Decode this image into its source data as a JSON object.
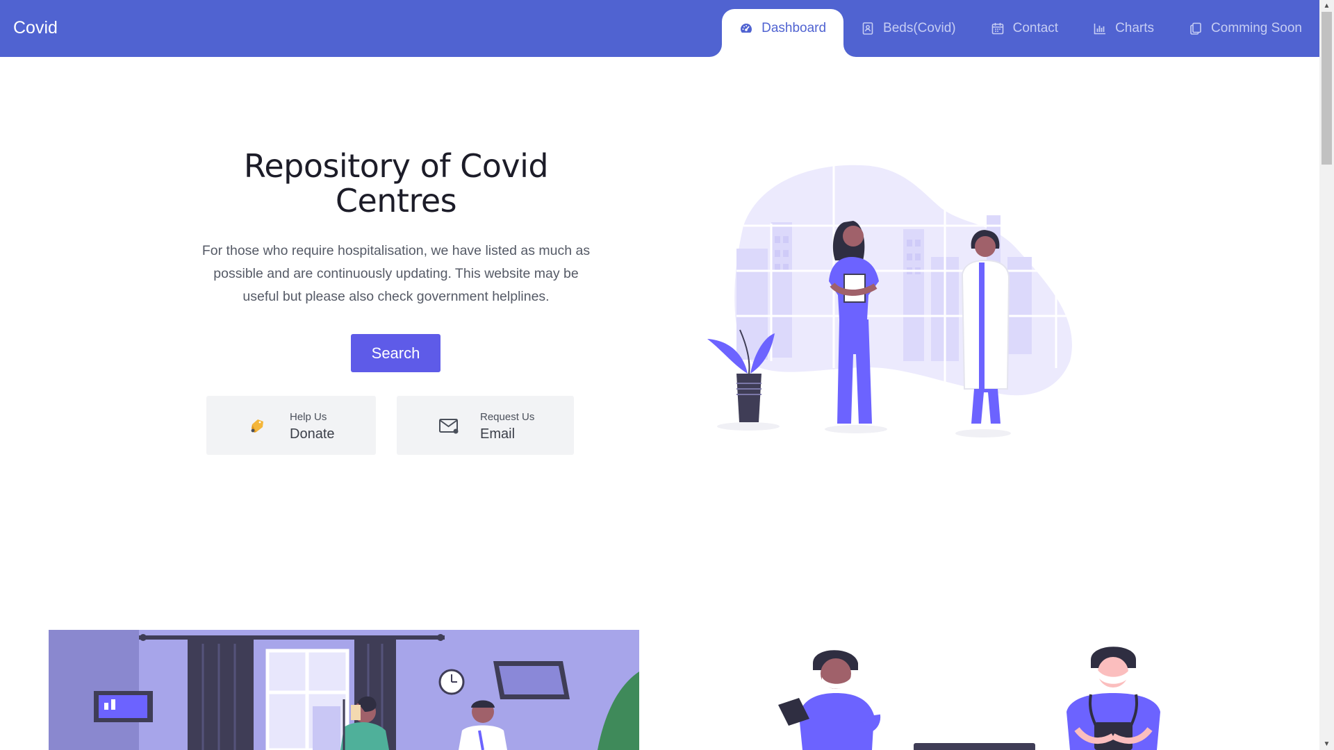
{
  "brand": "Covid",
  "nav": {
    "items": [
      {
        "label": "Dashboard",
        "icon": "gauge-icon",
        "active": true
      },
      {
        "label": "Beds(Covid)",
        "icon": "contact-book-icon",
        "active": false
      },
      {
        "label": "Contact",
        "icon": "calendar-icon",
        "active": false
      },
      {
        "label": "Charts",
        "icon": "bar-chart-icon",
        "active": false
      },
      {
        "label": "Comming Soon",
        "icon": "copy-icon",
        "active": false
      }
    ]
  },
  "hero": {
    "title": "Repository of Covid Centres",
    "description": "For those who require hospitalisation, we have listed as much as possible and are continuously updating. This website may be useful but please also check government helplines.",
    "search_label": "Search"
  },
  "cards": {
    "donate": {
      "small": "Help Us",
      "big": "Donate",
      "icon": "tag-icon"
    },
    "email": {
      "small": "Request Us",
      "big": "Email",
      "icon": "mail-icon"
    }
  },
  "colors": {
    "primary": "#5063d1",
    "button": "#5e5be8",
    "illustration_purple": "#6c63ff",
    "card_bg": "#f2f3f5"
  }
}
